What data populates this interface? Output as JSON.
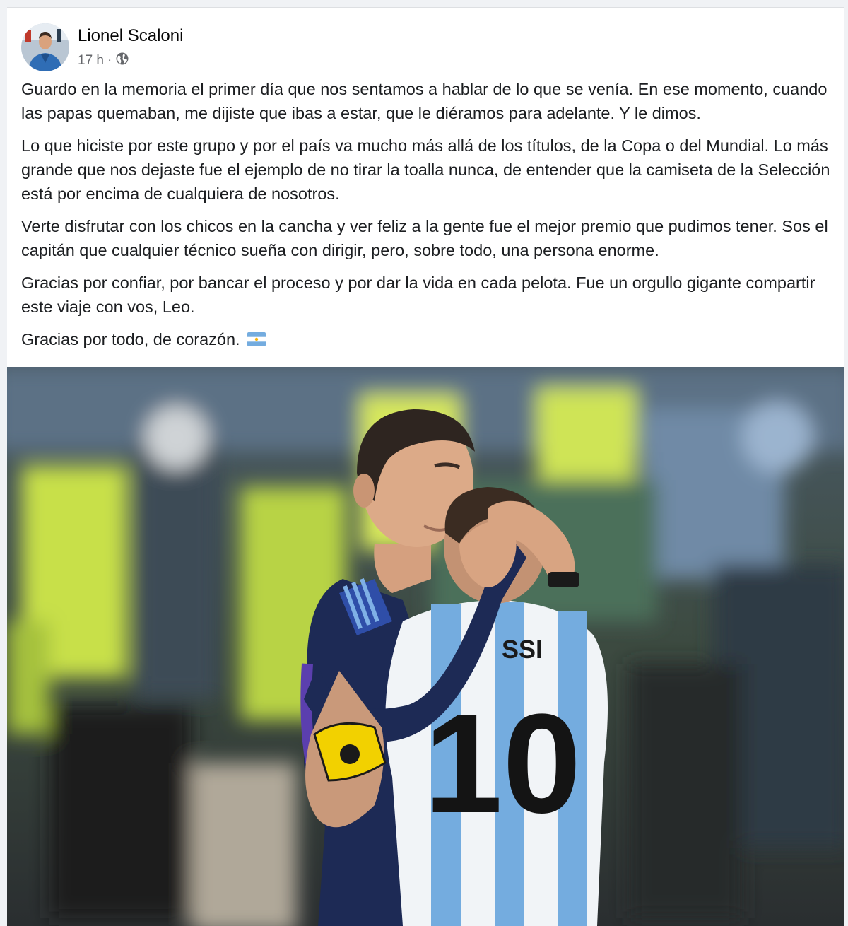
{
  "post": {
    "author": "Lionel Scaloni",
    "timestamp": "17 h",
    "separator": "·",
    "privacy_icon": "globe-icon",
    "paragraphs": [
      "Guardo en la memoria el primer día que nos sentamos a hablar de lo que se venía. En ese momento, cuando las papas quemaban, me dijiste que ibas a estar, que le diéramos para adelante. Y le dimos.",
      "Lo que hiciste por este grupo y por el país va mucho más allá de los títulos, de la Copa o del Mundial. Lo más grande que nos dejaste fue el ejemplo de no tirar la toalla nunca, de entender que la camiseta de la Selección está por encima de cualquiera de nosotros.",
      "Verte disfrutar con los chicos en la cancha y ver feliz a la gente fue el mejor premio que pudimos tener. Sos el capitán que cualquier técnico sueña con dirigir, pero, sobre todo, una persona enorme.",
      "Gracias por confiar, por bancar el proceso y por dar la vida en cada pelota. Fue un orgullo gigante compartir este viaje con vos, Leo.",
      "Gracias por todo, de corazón."
    ],
    "emoji": "argentina-flag-icon",
    "photo": {
      "jersey_name": "SSI",
      "jersey_number": "10"
    }
  },
  "colors": {
    "card": "#ffffff",
    "background": "#f0f2f5",
    "text": "#1c1e21",
    "meta": "#65676b",
    "argentina_blue": "#74acdf"
  }
}
